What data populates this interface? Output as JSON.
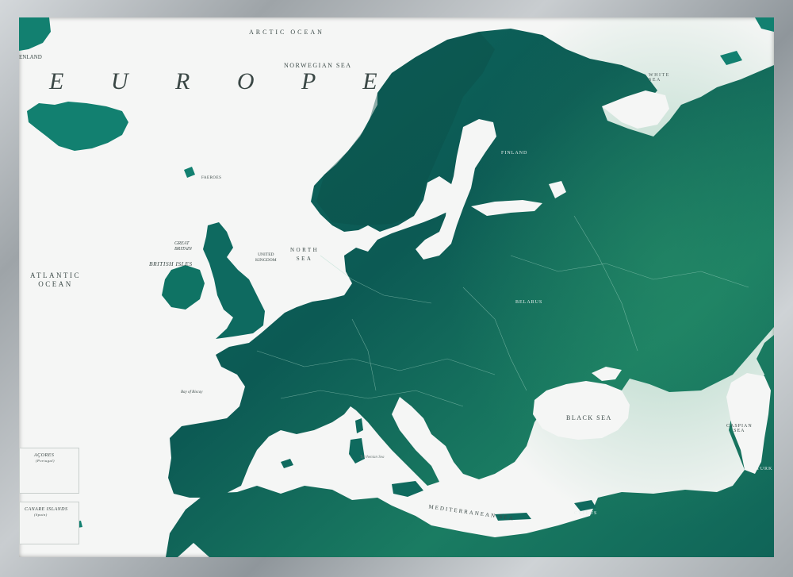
{
  "map": {
    "title": "E U R O P E",
    "colors": {
      "land": "#0f6a5e",
      "land_dark": "#0b4f4a",
      "land_light": "#2a8a6a",
      "water": "#f5f6f5",
      "frame": "#a9aeb2"
    },
    "labels": {
      "arctic_ocean": "ARCTIC OCEAN",
      "norwegian_sea": "NORWEGIAN SEA",
      "atlantic_ocean": "ATLANTIC\nOCEAN",
      "north_sea": "NORTH\nSEA",
      "white_sea": "WHITE\nSEA",
      "black_sea": "BLACK SEA",
      "caspian_sea": "CASPIAN\nSEA",
      "mediterranean_sea": "MEDITERRANEAN SEA",
      "british_isles": "BRITISH ISLES",
      "great_britain": "GREAT\nBRITAIN",
      "united_kingdom": "UNITED\nKINGDOM",
      "faeroes": "FAEROES",
      "greenland_fragment": "ENLAND",
      "bay_of_biscay": "Bay of Biscay",
      "tyrrhenian_sea": "Tyrrhenian Sea",
      "belarus": "BELARUS",
      "finland": "FINLAND",
      "cyprus": "CYPRUS",
      "turkey_fragment": "TURK"
    },
    "insets": [
      {
        "label": "AÇORES",
        "sublabel": "(Portugal)"
      },
      {
        "label": "CANARE ISLANDS",
        "sublabel": "(Spain)"
      }
    ]
  }
}
